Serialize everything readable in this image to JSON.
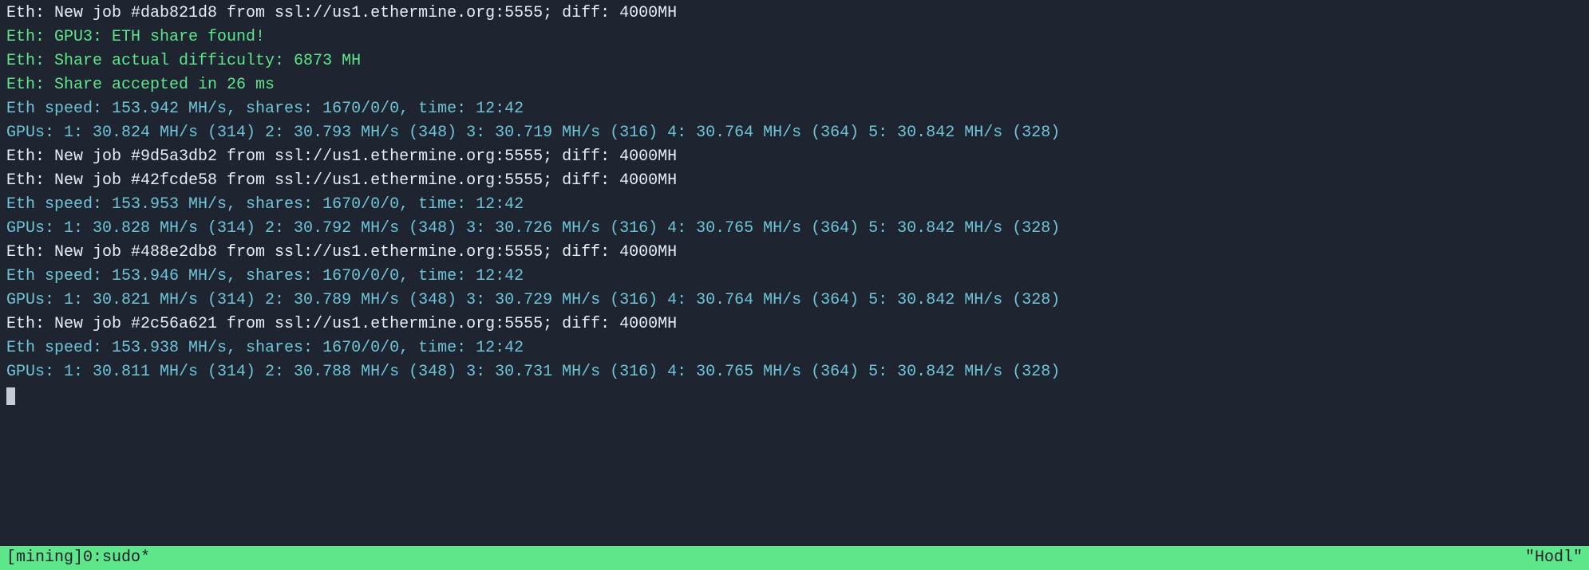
{
  "lines": [
    {
      "cls": "white",
      "text": "Eth: New job #dab821d8 from ssl://us1.ethermine.org:5555; diff: 4000MH"
    },
    {
      "cls": "green",
      "text": "Eth: GPU3: ETH share found!"
    },
    {
      "cls": "green",
      "text": "Eth: Share actual difficulty: 6873 MH"
    },
    {
      "cls": "green",
      "text": "Eth: Share accepted in 26 ms"
    },
    {
      "cls": "cyan",
      "text": "Eth speed: 153.942 MH/s, shares: 1670/0/0, time: 12:42"
    },
    {
      "cls": "cyan",
      "text": "GPUs: 1: 30.824 MH/s (314) 2: 30.793 MH/s (348) 3: 30.719 MH/s (316) 4: 30.764 MH/s (364) 5: 30.842 MH/s (328)"
    },
    {
      "cls": "white",
      "text": "Eth: New job #9d5a3db2 from ssl://us1.ethermine.org:5555; diff: 4000MH"
    },
    {
      "cls": "white",
      "text": "Eth: New job #42fcde58 from ssl://us1.ethermine.org:5555; diff: 4000MH"
    },
    {
      "cls": "cyan",
      "text": "Eth speed: 153.953 MH/s, shares: 1670/0/0, time: 12:42"
    },
    {
      "cls": "cyan",
      "text": "GPUs: 1: 30.828 MH/s (314) 2: 30.792 MH/s (348) 3: 30.726 MH/s (316) 4: 30.765 MH/s (364) 5: 30.842 MH/s (328)"
    },
    {
      "cls": "white",
      "text": "Eth: New job #488e2db8 from ssl://us1.ethermine.org:5555; diff: 4000MH"
    },
    {
      "cls": "cyan",
      "text": "Eth speed: 153.946 MH/s, shares: 1670/0/0, time: 12:42"
    },
    {
      "cls": "cyan",
      "text": "GPUs: 1: 30.821 MH/s (314) 2: 30.789 MH/s (348) 3: 30.729 MH/s (316) 4: 30.764 MH/s (364) 5: 30.842 MH/s (328)"
    },
    {
      "cls": "white",
      "text": "Eth: New job #2c56a621 from ssl://us1.ethermine.org:5555; diff: 4000MH"
    },
    {
      "cls": "cyan",
      "text": "Eth speed: 153.938 MH/s, shares: 1670/0/0, time: 12:42"
    },
    {
      "cls": "cyan",
      "text": "GPUs: 1: 30.811 MH/s (314) 2: 30.788 MH/s (348) 3: 30.731 MH/s (316) 4: 30.765 MH/s (364) 5: 30.842 MH/s (328)"
    }
  ],
  "statusbar": {
    "session": "[mining] ",
    "window": "0:sudo*",
    "host": "\"Hodl\""
  }
}
